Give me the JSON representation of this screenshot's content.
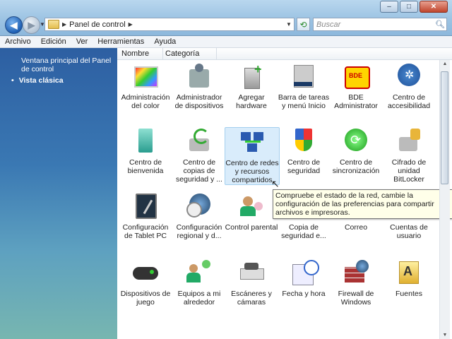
{
  "window": {
    "controls": {
      "minimize": "–",
      "maximize": "□",
      "close": "✕"
    }
  },
  "address": {
    "breadcrumb": "Panel de control",
    "search_placeholder": "Buscar"
  },
  "menu": [
    "Archivo",
    "Edición",
    "Ver",
    "Herramientas",
    "Ayuda"
  ],
  "left_pane": {
    "link": "Ventana principal del Panel de control",
    "item": "Vista clásica"
  },
  "columns": [
    "Nombre",
    "Categoría"
  ],
  "items": [
    {
      "label": "Administración del color",
      "icon": "color-management-icon"
    },
    {
      "label": "Administrador de dispositivos",
      "icon": "device-manager-icon"
    },
    {
      "label": "Agregar hardware",
      "icon": "add-hardware-icon"
    },
    {
      "label": "Barra de tareas y menú Inicio",
      "icon": "taskbar-start-menu-icon"
    },
    {
      "label": "BDE Administrator",
      "icon": "bde-administrator-icon"
    },
    {
      "label": "Centro de accesibilidad",
      "icon": "accessibility-icon"
    },
    {
      "label": "Centro de bienvenida",
      "icon": "welcome-center-icon"
    },
    {
      "label": "Centro de copias de seguridad y ...",
      "icon": "backup-center-icon"
    },
    {
      "label": "Centro de redes y recursos compartidos",
      "icon": "network-sharing-icon"
    },
    {
      "label": "Centro de seguridad",
      "icon": "security-center-icon"
    },
    {
      "label": "Centro de sincronización",
      "icon": "sync-center-icon"
    },
    {
      "label": "Cifrado de unidad BitLocker",
      "icon": "bitlocker-icon"
    },
    {
      "label": "Configuración de Tablet PC",
      "icon": "tablet-pc-icon"
    },
    {
      "label": "Configuración regional y d...",
      "icon": "regional-settings-icon"
    },
    {
      "label": "Control parental",
      "icon": "parental-control-icon"
    },
    {
      "label": "Copia de seguridad e...",
      "icon": "backup-icon"
    },
    {
      "label": "Correo",
      "icon": "mail-icon"
    },
    {
      "label": "Cuentas de usuario",
      "icon": "user-accounts-icon"
    },
    {
      "label": "Dispositivos de juego",
      "icon": "game-controller-icon"
    },
    {
      "label": "Equipos a mi alrededor",
      "icon": "people-near-me-icon"
    },
    {
      "label": "Escáneres y cámaras",
      "icon": "scanner-camera-icon"
    },
    {
      "label": "Fecha y hora",
      "icon": "date-time-icon"
    },
    {
      "label": "Firewall de Windows",
      "icon": "firewall-icon"
    },
    {
      "label": "Fuentes",
      "icon": "fonts-icon"
    }
  ],
  "tooltip": "Compruebe el estado de la red, cambie la configuración de las preferencias para compartir archivos e impresoras."
}
